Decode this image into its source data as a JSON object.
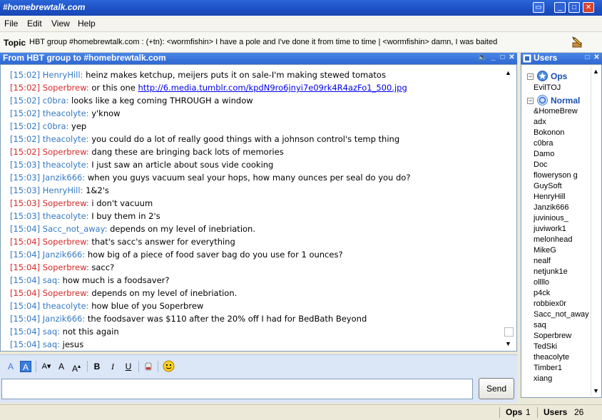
{
  "window": {
    "title": "#homebrewtalk.com"
  },
  "menu": [
    "File",
    "Edit",
    "View",
    "Help"
  ],
  "topic": {
    "label": "Topic",
    "text": "HBT group #homebrewtalk.com : (+tn): <wormfishin> I have a pole and I've done it from time to time | <wormfishin> damn, I was baited"
  },
  "channel": {
    "header": "From HBT group to #homebrewtalk.com"
  },
  "messages": [
    {
      "time": "[15:02]",
      "nick": "HenryHill:",
      "text": "heinz makes ketchup, meijers puts it on sale-I'm making stewed tomatos",
      "color": "b"
    },
    {
      "time": "[15:02]",
      "nick": "Soperbrew:",
      "text": "or this one ",
      "link": "http://6.media.tumblr.com/kpdN9ro6jnyi7e09rk4R4azFo1_500.jpg",
      "color": "r"
    },
    {
      "time": "[15:02]",
      "nick": "c0bra:",
      "text": "looks like a keg coming THROUGH a window",
      "color": "b"
    },
    {
      "time": "[15:02]",
      "nick": "theacolyte:",
      "text": "y'know",
      "color": "b"
    },
    {
      "time": "[15:02]",
      "nick": "c0bra:",
      "text": "yep",
      "color": "b"
    },
    {
      "time": "[15:02]",
      "nick": "theacolyte:",
      "text": "you could do a lot of really good things with a johnson control's temp thing",
      "color": "b"
    },
    {
      "time": "[15:02]",
      "nick": "Soperbrew:",
      "text": "dang these are bringing back lots of memories",
      "color": "r"
    },
    {
      "time": "[15:03]",
      "nick": "theacolyte:",
      "text": "I just saw an article about sous vide cooking",
      "color": "b"
    },
    {
      "time": "[15:03]",
      "nick": "Janzik666:",
      "text": "when you guys vacuum seal your hops, how many ounces per seal do you do?",
      "color": "b"
    },
    {
      "time": "[15:03]",
      "nick": "HenryHill:",
      "text": "1&2's",
      "color": "b"
    },
    {
      "time": "[15:03]",
      "nick": "Soperbrew:",
      "text": "i don't vacuum",
      "color": "r"
    },
    {
      "time": "[15:03]",
      "nick": "theacolyte:",
      "text": "I buy them in 2's",
      "color": "b"
    },
    {
      "time": "[15:04]",
      "nick": "Sacc_not_away:",
      "text": "depends on my level of inebriation.",
      "color": "b"
    },
    {
      "time": "[15:04]",
      "nick": "Soperbrew:",
      "text": "that's sacc's answer for everything",
      "color": "r"
    },
    {
      "time": "[15:04]",
      "nick": "Janzik666:",
      "text": "how big of a piece of food saver bag do you use for 1 ounces?",
      "color": "b"
    },
    {
      "time": "[15:04]",
      "nick": "Soperbrew:",
      "text": "sacc?",
      "color": "r"
    },
    {
      "time": "[15:04]",
      "nick": "saq:",
      "text": "how much is a foodsaver?",
      "color": "b"
    },
    {
      "time": "[15:04]",
      "nick": "Soperbrew:",
      "text": "depends on my level of inebriation.",
      "color": "r"
    },
    {
      "time": "[15:04]",
      "nick": "theacolyte:",
      "text": "how blue of you Soperbrew",
      "color": "b"
    },
    {
      "time": "[15:04]",
      "nick": "Janzik666:",
      "text": "the foodsaver was $110 after the 20% off I had for BedBath Beyond",
      "color": "b"
    },
    {
      "time": "[15:04]",
      "nick": "saq:",
      "text": "not this again",
      "color": "b"
    },
    {
      "time": "[15:04]",
      "nick": "saq:",
      "text": "jesus",
      "color": "b"
    }
  ],
  "input": {
    "send_label": "Send",
    "value": ""
  },
  "users_panel": {
    "header": "Users",
    "ops_label": "Ops",
    "normal_label": "Normal",
    "ops": [
      "EvilTOJ"
    ],
    "normal": [
      "&HomeBrew",
      "adx",
      "Bokonon",
      "c0bra",
      "Damo",
      "Doc",
      "floweryson g",
      "GuySoft",
      "HenryHill",
      "Janzik666",
      "juvinious_",
      "juviwork1",
      "melonhead",
      "MikeG",
      "nealf",
      "netjunk1e",
      "ollllo",
      "p4ck",
      "robbiex0r",
      "Sacc_not_away",
      "saq",
      "Soperbrew",
      "TedSki",
      "theacolyte",
      "Timber1",
      "xiang"
    ]
  },
  "status": {
    "ops_label": "Ops",
    "ops_count": "1",
    "users_label": "Users",
    "users_count": "26"
  },
  "colors": {
    "title": "#1c4fc3",
    "timestamp_blue": "#3379c4",
    "timestamp_red": "#d42a2a"
  }
}
